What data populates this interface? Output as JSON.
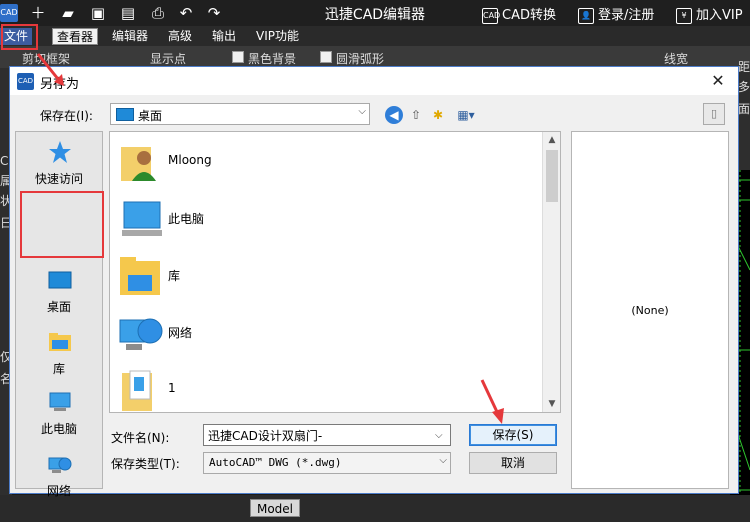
{
  "app": {
    "title": "迅捷CAD编辑器",
    "logo_text": "CAD",
    "top_right": {
      "convert": "CAD转换",
      "login": "登录/注册",
      "vip": "加入VIP"
    }
  },
  "menubar": {
    "items": [
      "文件",
      "查看器",
      "编辑器",
      "高级",
      "输出",
      "VIP功能"
    ]
  },
  "toolbar": {
    "items": [
      "剪切框架",
      "显示点",
      "黑色背景",
      "圆滑弧形",
      "线宽"
    ],
    "right_chars": [
      "距",
      "多",
      "面"
    ]
  },
  "left_strip_chars": [
    "C",
    "属",
    "状",
    "日",
    "仅",
    "名"
  ],
  "model_tab": "Model",
  "dialog": {
    "title": "另存为",
    "icon_text": "CAD",
    "close": "✕",
    "save_in_label": "保存在(I):",
    "save_in_value": "桌面",
    "places": [
      "快速访问",
      "桌面",
      "库",
      "此电脑",
      "网络"
    ],
    "files": [
      "Mloong",
      "此电脑",
      "库",
      "网络",
      "1"
    ],
    "filename_label": "文件名(N):",
    "filename_value": "迅捷CAD设计双扇门-",
    "filetype_label": "保存类型(T):",
    "filetype_value": "AutoCAD™ DWG (*.dwg)",
    "save_button": "保存(S)",
    "cancel_button": "取消",
    "preview_text": "(None)"
  },
  "colors": {
    "highlight_red": "#e5383b",
    "accent_blue": "#2a7ad4"
  }
}
